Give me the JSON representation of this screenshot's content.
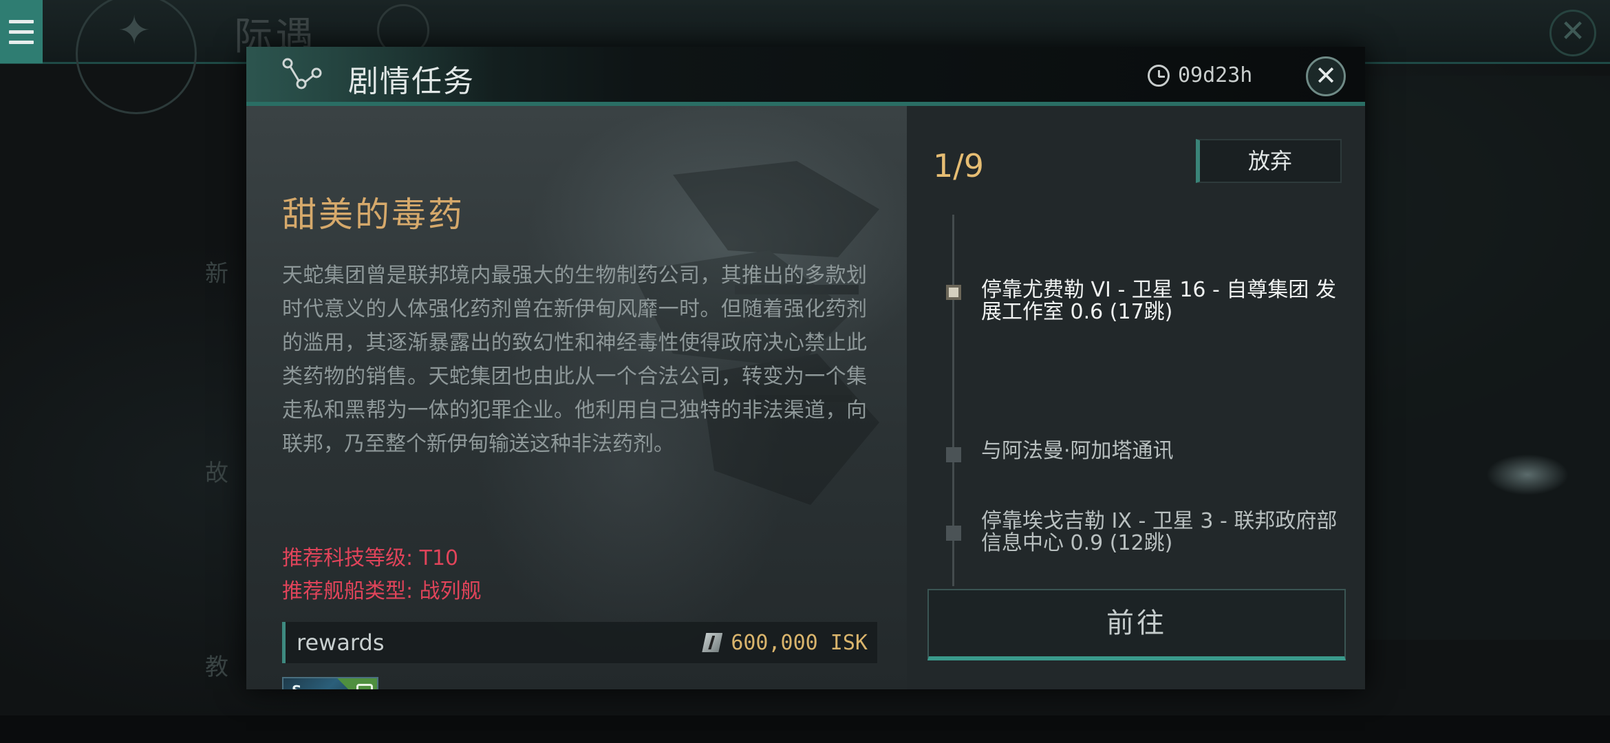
{
  "background": {
    "title": "际遇",
    "side_items": [
      "新",
      "故",
      "教"
    ]
  },
  "dialog": {
    "title": "剧情任务",
    "timer": "09d23h",
    "close_icon": "close-icon",
    "mission": {
      "name": "甜美的毒药",
      "description": "天蛇集团曾是联邦境内最强大的生物制药公司，其推出的多款划时代意义的人体强化药剂曾在新伊甸风靡一时。但随着强化药剂的滥用，其逐渐暴露出的致幻性和神经毒性使得政府决心禁止此类药物的销售。天蛇集团也由此从一个合法公司，转变为一个集走私和黑帮为一体的犯罪企业。他利用自己独特的非法渠道，向联邦，乃至整个新伊甸输送这种非法药剂。",
      "recommended_tech": "推荐科技等级: T10",
      "recommended_ship": "推荐舰船类型: 战列舰",
      "rewards_label": "rewards",
      "isk_amount": "600,000 ISK",
      "reward_item_tier": "S"
    },
    "progress": "1/9",
    "abandon_label": "放弃",
    "steps": [
      {
        "text": "停靠尤费勒 VI - 卫星 16 - 自尊集团 发展工作室 0.6 (17跳)",
        "active": true
      },
      {
        "text": "与阿法曼·阿加塔通讯",
        "active": false
      },
      {
        "text": "停靠埃戈吉勒 IX - 卫星 3 - 联邦政府部 信息中心 0.9 (12跳)",
        "active": false
      }
    ],
    "go_label": "前往"
  },
  "colors": {
    "accent_teal": "#3a9a8c",
    "mission_name": "#d6a96b",
    "recommend_red": "#e0445a",
    "isk_gold": "#d9b46c",
    "progress_gold": "#e6bd73"
  }
}
